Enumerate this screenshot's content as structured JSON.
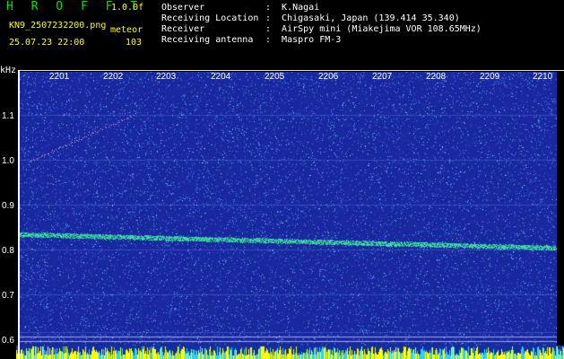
{
  "header": {
    "app_title": "H R O F F T",
    "version": "1.0.0f",
    "filename": "KN9_2507232200.png",
    "meteor_label": "meteor",
    "datetime": "25.07.23 22:00",
    "meteor_count": "103",
    "info": [
      {
        "label": "Observer",
        "value": ":  K.Nagai"
      },
      {
        "label": "Receiving Location",
        "value": ":  Chigasaki, Japan (139.414 35.340)"
      },
      {
        "label": "Receiver",
        "value": ":  AirSpy mini (Miakejima VOR 108.65MHz)"
      },
      {
        "label": "Receiving antenna",
        "value": ":  Maspro FM-3"
      }
    ]
  },
  "spectrogram": {
    "y_unit": "kHz",
    "y_ticks": [
      "1.1",
      "1.0",
      "0.9",
      "0.8",
      "0.7",
      "0.6"
    ],
    "x_ticks": [
      "2201",
      "2202",
      "2203",
      "2204",
      "2205",
      "2206",
      "2207",
      "2208",
      "2209",
      "2210"
    ],
    "colors": {
      "background": "#1a28a0",
      "noise": "#3a6ad8",
      "signal": "#40e890",
      "baseline": "#ffff00"
    }
  }
}
